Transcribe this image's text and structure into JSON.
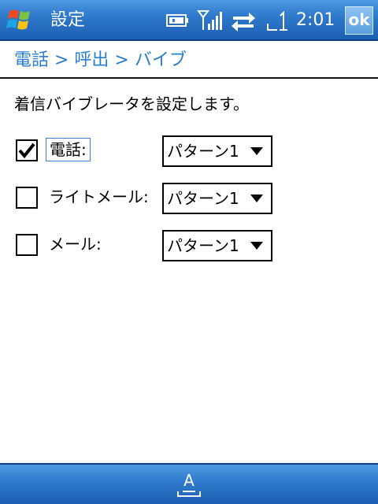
{
  "titlebar": {
    "title": "設定",
    "clock": "2:01",
    "ok_label": "ok",
    "icons": [
      "start-windows-icon",
      "battery-icon",
      "signal-icon",
      "sync-arrows-icon",
      "network-icon"
    ]
  },
  "breadcrumb": "電話 > 呼出 > バイブ",
  "description": "着信バイブレータを設定します。",
  "rows": [
    {
      "label": "電話:",
      "checked": true,
      "select_value": "パターン1"
    },
    {
      "label": "ライトメール:",
      "checked": false,
      "select_value": "パターン1"
    },
    {
      "label": "メール:",
      "checked": false,
      "select_value": "パターン1"
    }
  ],
  "bottombar": {
    "keyboard_letter": "A"
  },
  "colors": {
    "accent": "#2e79cb",
    "breadcrumb": "#2a7fd0"
  }
}
